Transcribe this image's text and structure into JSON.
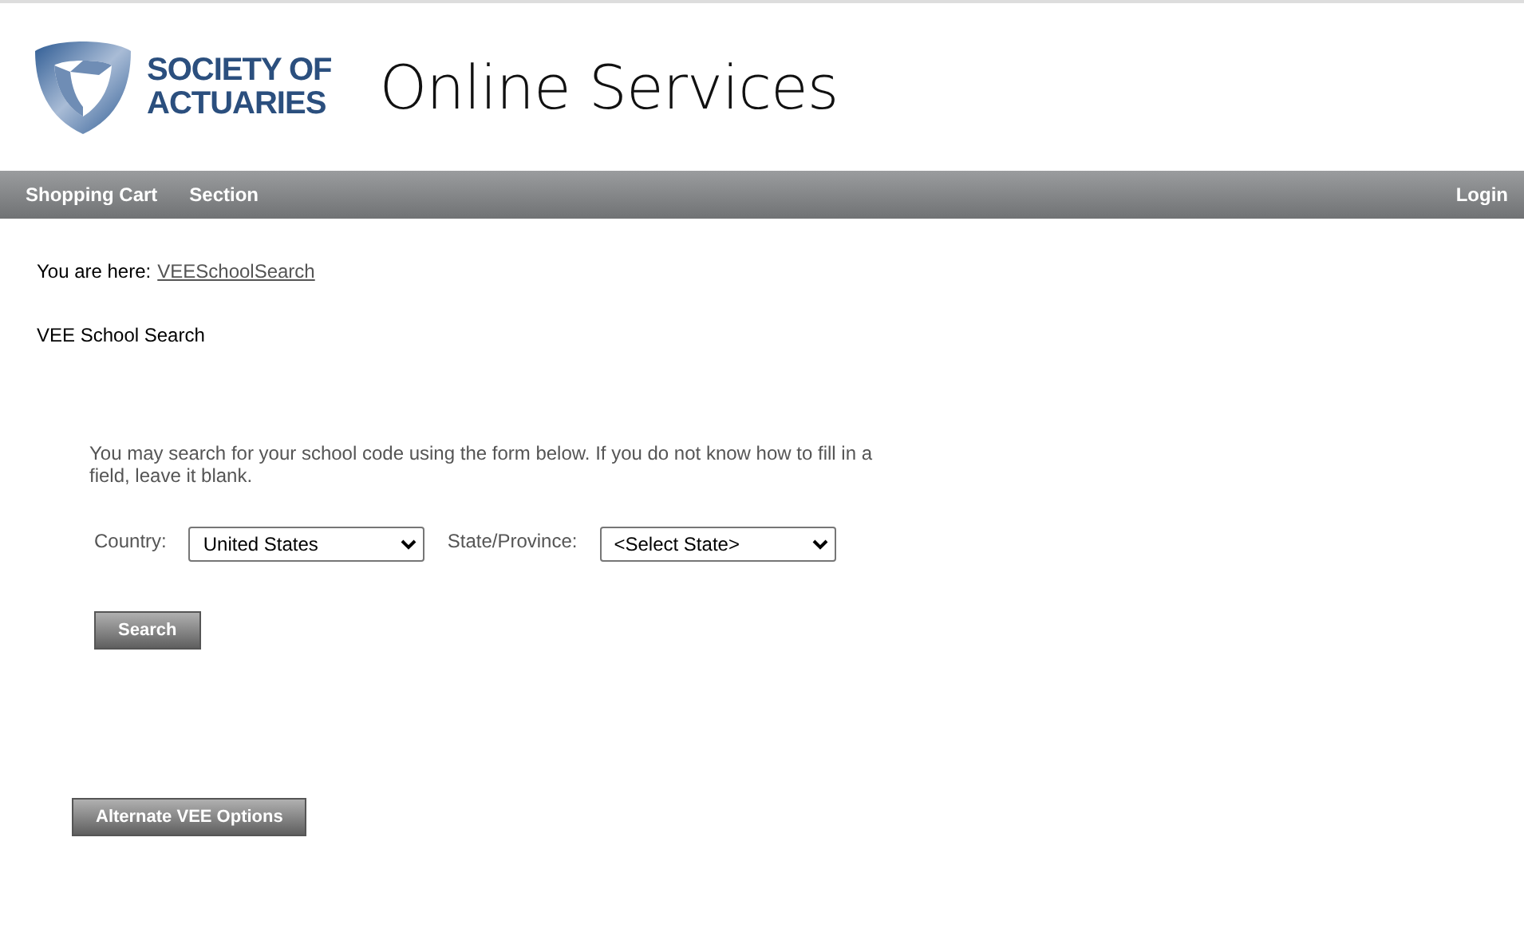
{
  "logo": {
    "lines": [
      "SOCIETY OF",
      "ACTUARIES"
    ]
  },
  "site_title": "Online Services",
  "nav": {
    "left": [
      "Shopping Cart",
      "Section"
    ],
    "right": [
      "Login"
    ]
  },
  "breadcrumb": {
    "label": "You are here:",
    "link": "VEESchoolSearch"
  },
  "page_title": "VEE School Search",
  "intro": "You may search for your school code using the form below. If you do not know how to fill in a field, leave it blank.",
  "fields": [
    {
      "label": "Country:",
      "value": "United States"
    },
    {
      "label": "State/Province:",
      "value": "<Select State>"
    }
  ],
  "search_button": "Search",
  "alternate_button": "Alternate VEE Options"
}
